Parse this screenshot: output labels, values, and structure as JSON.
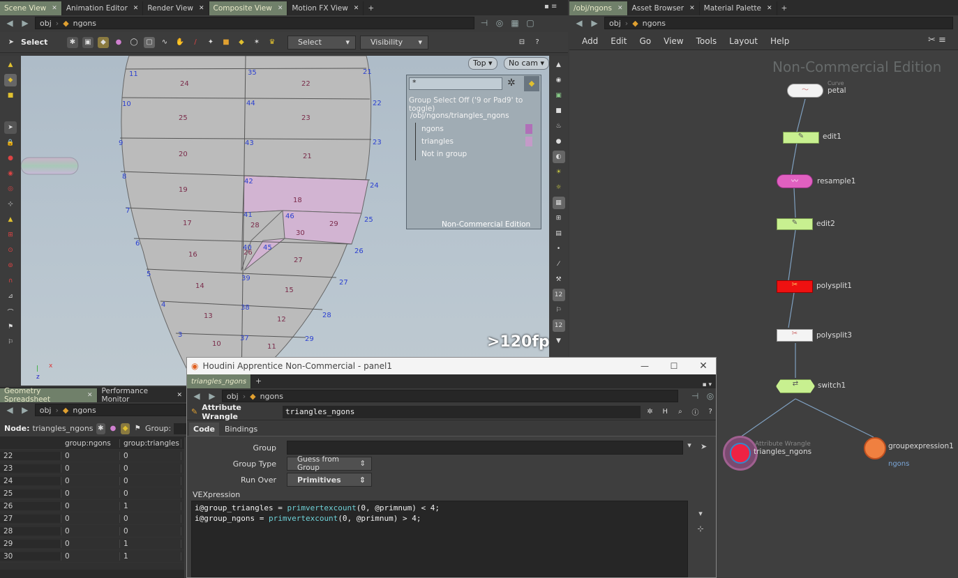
{
  "left_tabs": [
    {
      "label": "Scene View",
      "active": true
    },
    {
      "label": "Animation Editor",
      "active": false
    },
    {
      "label": "Render View",
      "active": false
    },
    {
      "label": "Composite View",
      "active": true
    },
    {
      "label": "Motion FX View",
      "active": false
    }
  ],
  "right_tabs": [
    {
      "label": "/obj/ngons",
      "active": true
    },
    {
      "label": "Asset Browser",
      "active": false
    },
    {
      "label": "Material Palette",
      "active": false
    }
  ],
  "path": {
    "root": "obj",
    "node": "ngons"
  },
  "viewport_toolbar": {
    "select_label": "Select",
    "select_combo": "Select",
    "visibility_combo": "Visibility"
  },
  "viewport": {
    "camera_view": "Top",
    "camera": "No cam",
    "fps": ">120fps",
    "group_filter": "*",
    "group_select_hint": "Group Select Off ('9 or Pad9' to toggle)",
    "group_path": "/obj/ngons/triangles_ngons",
    "groups": [
      "ngons",
      "triangles",
      "Not in group"
    ],
    "group_colors": [
      "#b070b8",
      "#c49ac8"
    ],
    "watermark": "Non-Commercial Edition",
    "point_numbers": [
      "11",
      "35",
      "21",
      "10",
      "44",
      "22",
      "9",
      "43",
      "23",
      "8",
      "42",
      "24",
      "7",
      "41",
      "46",
      "25",
      "6",
      "40",
      "45",
      "26",
      "5",
      "39",
      "27",
      "4",
      "38",
      "28",
      "3",
      "37",
      "29"
    ],
    "prim_numbers": [
      "24",
      "22",
      "25",
      "23",
      "20",
      "21",
      "19",
      "18",
      "17",
      "28",
      "30",
      "29",
      "16",
      "26",
      "27",
      "14",
      "15",
      "13",
      "12",
      "10",
      "11"
    ]
  },
  "network": {
    "menu": [
      "Add",
      "Edit",
      "Go",
      "View",
      "Tools",
      "Layout",
      "Help"
    ],
    "watermark": "Non-Commercial Edition",
    "nodes": [
      {
        "name": "petal",
        "type": "Curve"
      },
      {
        "name": "edit1"
      },
      {
        "name": "resample1"
      },
      {
        "name": "edit2"
      },
      {
        "name": "polysplit1"
      },
      {
        "name": "polysplit3"
      },
      {
        "name": "switch1"
      },
      {
        "name": "triangles_ngons",
        "type": "Attribute Wrangle"
      },
      {
        "name": "groupexpression1",
        "sub": "ngons"
      }
    ]
  },
  "spreadsheet": {
    "tabs": [
      "Geometry Spreadsheet",
      "Performance Monitor"
    ],
    "node_label": "Node:",
    "node_name": "triangles_ngons",
    "group_label": "Group:",
    "columns": [
      "",
      "group:ngons",
      "group:triangles"
    ],
    "rows": [
      [
        "22",
        "0",
        "0"
      ],
      [
        "23",
        "0",
        "0"
      ],
      [
        "24",
        "0",
        "0"
      ],
      [
        "25",
        "0",
        "0"
      ],
      [
        "26",
        "0",
        "1"
      ],
      [
        "27",
        "0",
        "0"
      ],
      [
        "28",
        "0",
        "0"
      ],
      [
        "29",
        "0",
        "1"
      ],
      [
        "30",
        "0",
        "1"
      ]
    ]
  },
  "floating_panel": {
    "title": "Houdini Apprentice Non-Commercial - panel1",
    "tab": "triangles_ngons",
    "node_type": "Attribute Wrangle",
    "node_name": "triangles_ngons",
    "tabs": [
      "Code",
      "Bindings"
    ],
    "params": {
      "group_label": "Group",
      "group_value": "",
      "group_type_label": "Group Type",
      "group_type_value": "Guess from Group",
      "run_over_label": "Run Over",
      "run_over_value": "Primitives",
      "vex_label": "VEXpression"
    },
    "code_lines": [
      "i@group_triangles = primvertexcount(0, @primnum) < 4;",
      "i@group_ngons = primvertexcount(0, @primnum) > 4;"
    ]
  }
}
